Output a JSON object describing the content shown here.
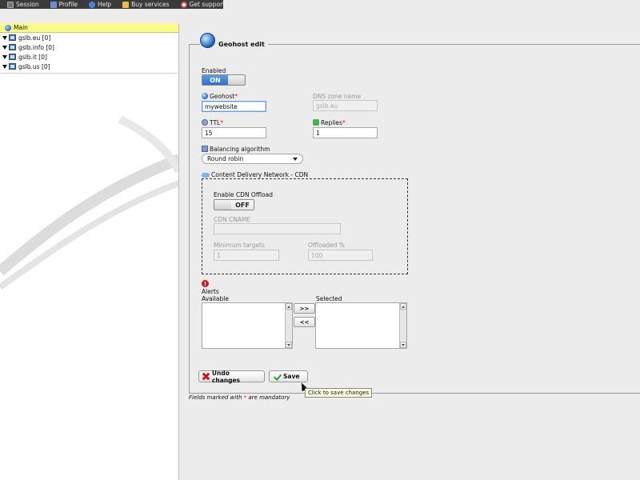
{
  "topbar": {
    "items": [
      {
        "label": "Session",
        "icon": "terminal-icon",
        "color": "#777777"
      },
      {
        "label": "Profile",
        "icon": "users-icon",
        "color": "#6c8fd6"
      },
      {
        "label": "Help",
        "icon": "help-icon",
        "color": "#4a86d8"
      },
      {
        "label": "Buy services",
        "icon": "pencil-icon",
        "color": "#e6c14a"
      },
      {
        "label": "Get support",
        "icon": "lifebuoy-icon",
        "color": "#e05050"
      }
    ]
  },
  "tree": {
    "root": "Main",
    "zones": [
      "gslb.eu [0]",
      "gslb.info [0]",
      "gslb.it [0]",
      "gslb.us [0]"
    ]
  },
  "form": {
    "legend": "Geohost edit",
    "enabled_label": "Enabled",
    "enabled_state": "ON",
    "geohost_label": "Geohost",
    "required_mark": "*",
    "geohost_value": "mywebsite",
    "dns_zone_label": "DNS zone name",
    "dns_zone_value": "gslb.eu",
    "ttl_label": "TTL",
    "ttl_value": "15",
    "replies_label": "Replies",
    "replies_value": "1",
    "balancing_label": "Balancing algorithm",
    "balancing_value": "Round robin",
    "cdn_legend": "Content Delivery Network - CDN",
    "cdn_offload_label": "Enable CDN Offload",
    "cdn_offload_state": "OFF",
    "cdn_cname_label": "CDN CNAME",
    "cdn_cname_value": "",
    "min_targets_label": "Minimum targets",
    "min_targets_value": "1",
    "offloaded_label": "Offloaded %",
    "offloaded_value": "100",
    "alert_mark": "!",
    "alerts_label": "Alerts",
    "available_label": "Available",
    "selected_label": "Selected",
    "move_right": ">>",
    "move_left": "<<",
    "undo_label": "Undo changes",
    "save_label": "Save",
    "save_tooltip": "Click to save changes",
    "mandatory_prefix": "Fields marked with",
    "mandatory_suffix": "are mandatory"
  }
}
